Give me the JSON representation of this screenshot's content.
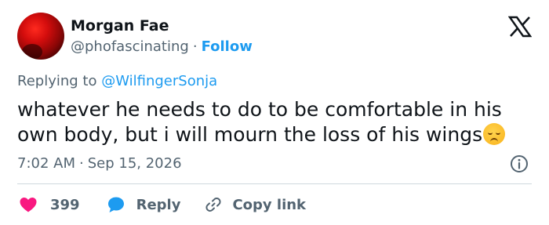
{
  "author": {
    "name": "Morgan Fae",
    "handle": "@phofascinating",
    "separator": "·",
    "follow_label": "Follow"
  },
  "reply_context": {
    "prefix": "Replying to",
    "mention": "@WilfingerSonja"
  },
  "tweet": {
    "text": "whatever he needs to do to be comfortable in his own body, but i will mourn the loss of his wings",
    "emoji": "pensive-face-emoji"
  },
  "meta": {
    "time": "7:02 AM",
    "separator": "·",
    "date": "Sep 15, 2026"
  },
  "actions": {
    "likes_count": "399",
    "reply_label": "Reply",
    "copy_label": "Copy link"
  },
  "colors": {
    "accent": "#1d9bf0",
    "like": "#f91880",
    "text": "#0f1419",
    "muted": "#536471",
    "divider": "#cfd9de"
  },
  "icons": [
    "x-logo-icon",
    "info-icon",
    "heart-icon",
    "reply-bubble-icon",
    "link-icon"
  ]
}
